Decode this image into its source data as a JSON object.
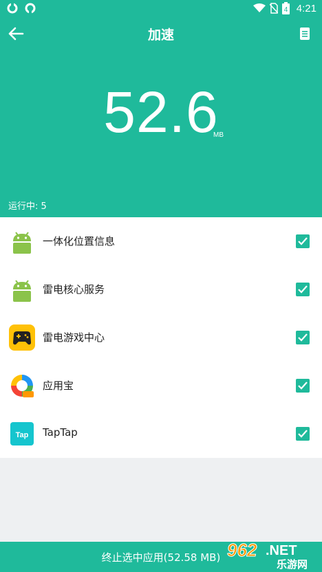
{
  "status_bar": {
    "time": "4:21",
    "battery": "4"
  },
  "appbar": {
    "title": "加速"
  },
  "memory": {
    "value": "52.6",
    "unit": "MB"
  },
  "running_text": "运行中: 5",
  "apps": [
    {
      "name": "一体化位置信息",
      "icon": "android-icon",
      "checked": true
    },
    {
      "name": "雷电核心服务",
      "icon": "android-icon",
      "checked": true
    },
    {
      "name": "雷电游戏中心",
      "icon": "gamepad-icon",
      "checked": true
    },
    {
      "name": "应用宝",
      "icon": "yingyongbao-icon",
      "checked": true
    },
    {
      "name": "TapTap",
      "icon": "taptap-icon",
      "checked": true
    }
  ],
  "bottom_button": "终止选中应用(52.58 MB)",
  "watermark": {
    "text": "962",
    "suffix": ".NET",
    "sub": "乐游网"
  },
  "colors": {
    "accent": "#1fba9b",
    "list_bg": "#ffffff",
    "page_bg": "#eef0f2"
  }
}
